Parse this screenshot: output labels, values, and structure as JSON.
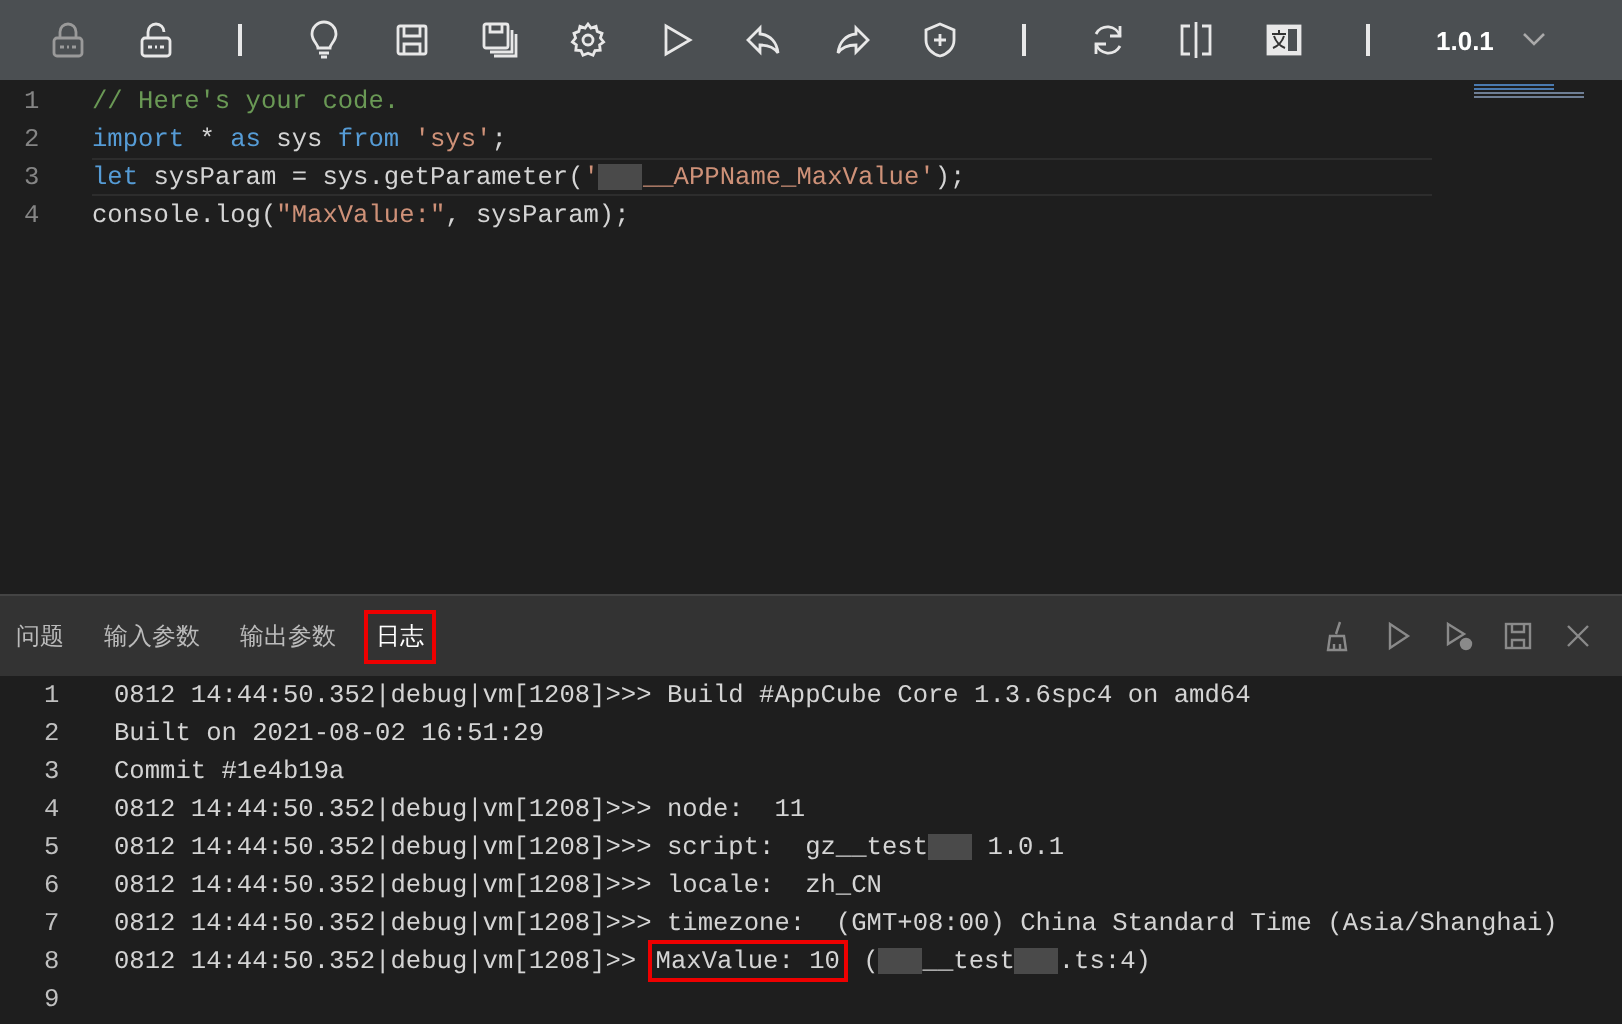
{
  "toolbar": {
    "tools": [
      {
        "kind": "lock",
        "disabled": true
      },
      {
        "kind": "unlock",
        "disabled": false
      },
      {
        "kind": "separator"
      },
      {
        "kind": "bulb",
        "disabled": false
      },
      {
        "kind": "save",
        "disabled": false
      },
      {
        "kind": "save-all",
        "disabled": false
      },
      {
        "kind": "gear",
        "disabled": false
      },
      {
        "kind": "play",
        "disabled": false
      },
      {
        "kind": "undo",
        "disabled": false
      },
      {
        "kind": "redo",
        "disabled": false
      },
      {
        "kind": "shield",
        "disabled": false
      },
      {
        "kind": "separator"
      },
      {
        "kind": "refresh",
        "disabled": false
      },
      {
        "kind": "split",
        "disabled": false
      },
      {
        "kind": "translate",
        "disabled": false
      },
      {
        "kind": "separator"
      }
    ],
    "version": "1.0.1"
  },
  "editor": {
    "lines": [
      {
        "number": "1",
        "current": false,
        "tokens": [
          {
            "kind": "comment",
            "text": "// Here's your code."
          }
        ]
      },
      {
        "number": "2",
        "current": false,
        "tokens": [
          {
            "kind": "keyword",
            "text": "import"
          },
          {
            "kind": "plain",
            "text": " * "
          },
          {
            "kind": "keyword",
            "text": "as"
          },
          {
            "kind": "plain",
            "text": " sys "
          },
          {
            "kind": "keyword",
            "text": "from"
          },
          {
            "kind": "string",
            "text": " 'sys'"
          },
          {
            "kind": "plain",
            "text": ";"
          }
        ]
      },
      {
        "number": "3",
        "current": true,
        "tokens": [
          {
            "kind": "keyword",
            "text": "let"
          },
          {
            "kind": "plain",
            "text": " sysParam = sys.getParameter("
          },
          {
            "kind": "string",
            "text": "'"
          },
          {
            "kind": "redacted"
          },
          {
            "kind": "string",
            "text": "__APPName_MaxValue'"
          },
          {
            "kind": "plain",
            "text": ");"
          }
        ]
      },
      {
        "number": "4",
        "current": false,
        "tokens": [
          {
            "kind": "plain",
            "text": "console.log("
          },
          {
            "kind": "string",
            "text": "\"MaxValue:\""
          },
          {
            "kind": "plain",
            "text": ", sysParam);"
          }
        ]
      }
    ]
  },
  "panel": {
    "tabs": [
      {
        "label": "问题",
        "selected": false
      },
      {
        "label": "输入参数",
        "selected": false
      },
      {
        "label": "输出参数",
        "selected": false
      },
      {
        "label": "日志",
        "selected": true
      }
    ],
    "actions": [
      {
        "kind": "broom"
      },
      {
        "kind": "play"
      },
      {
        "kind": "run-step"
      },
      {
        "kind": "save"
      },
      {
        "kind": "close"
      }
    ],
    "log": [
      {
        "number": "1",
        "segments": [
          {
            "kind": "plain",
            "text": "0812 14:44:50.352|debug|vm[1208]>>> Build #AppCube Core 1.3.6spc4 on amd64"
          }
        ]
      },
      {
        "number": "2",
        "segments": [
          {
            "kind": "plain",
            "text": "Built on 2021-08-02 16:51:29"
          }
        ]
      },
      {
        "number": "3",
        "segments": [
          {
            "kind": "plain",
            "text": "Commit #1e4b19a"
          }
        ]
      },
      {
        "number": "4",
        "segments": [
          {
            "kind": "plain",
            "text": "0812 14:44:50.352|debug|vm[1208]>>> node:  11"
          }
        ]
      },
      {
        "number": "5",
        "segments": [
          {
            "kind": "plain",
            "text": "0812 14:44:50.352|debug|vm[1208]>>> script:  gz__test"
          },
          {
            "kind": "redacted"
          },
          {
            "kind": "plain",
            "text": " 1.0.1"
          }
        ]
      },
      {
        "number": "6",
        "segments": [
          {
            "kind": "plain",
            "text": "0812 14:44:50.352|debug|vm[1208]>>> locale:  zh_CN"
          }
        ]
      },
      {
        "number": "7",
        "segments": [
          {
            "kind": "plain",
            "text": "0812 14:44:50.352|debug|vm[1208]>>> timezone:  (GMT+08:00) China Standard Time (Asia/Shanghai)"
          }
        ]
      },
      {
        "number": "8",
        "segments": [
          {
            "kind": "plain",
            "text": "0812 14:44:50.352|debug|vm[1208]>> "
          },
          {
            "kind": "highlight",
            "text": "MaxValue: 10"
          },
          {
            "kind": "plain",
            "text": " ("
          },
          {
            "kind": "redacted"
          },
          {
            "kind": "plain",
            "text": "__test"
          },
          {
            "kind": "redacted"
          },
          {
            "kind": "plain",
            "text": ".ts:4)"
          }
        ]
      },
      {
        "number": "9"
      }
    ]
  }
}
